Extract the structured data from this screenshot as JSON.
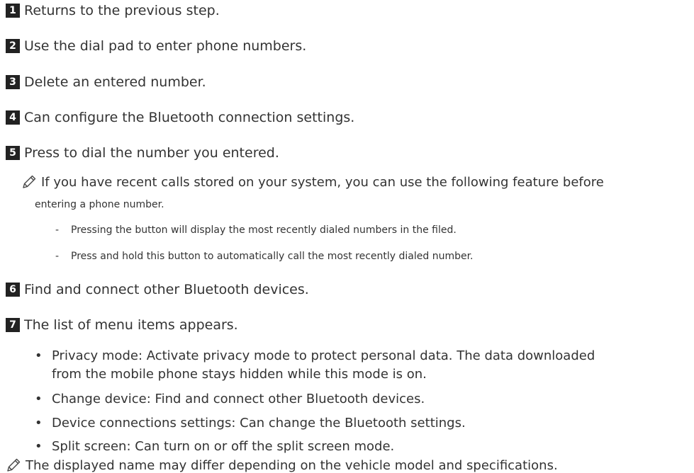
{
  "steps": [
    {
      "number": "1",
      "text": "Returns to the previous step."
    },
    {
      "number": "2",
      "text": "Use the dial pad to enter phone numbers."
    },
    {
      "number": "3",
      "text": "Delete an entered number."
    },
    {
      "number": "4",
      "text": "Can configure the Bluetooth connection settings."
    },
    {
      "number": "5",
      "text": "Press to dial the number you entered."
    },
    {
      "number": "6",
      "text": "Find and connect other Bluetooth devices."
    },
    {
      "number": "7",
      "text": "The list of menu items appears."
    }
  ],
  "step5_note": {
    "line1": "If you have recent calls stored on your system, you can use the following feature before",
    "line2": "entering a phone number.",
    "dash_items": [
      "Pressing the button will display the most recently dialed numbers in the filed.",
      "Press and hold this button to automatically call the most recently dialed number."
    ]
  },
  "step7_bullets": [
    {
      "line1": "Privacy mode: Activate privacy mode to protect personal data. The data downloaded",
      "line2": "from the mobile phone stays hidden while this mode is on."
    },
    {
      "line1": "Change device: Find and connect other Bluetooth devices."
    },
    {
      "line1": "Device connections settings: Can change the Bluetooth settings."
    },
    {
      "line1": "Split screen: Can turn on or off the split screen mode."
    }
  ],
  "footer_note": "The displayed name may differ depending on the vehicle model and specifications.",
  "icons": {
    "note": "pencil-icon"
  },
  "colors": {
    "badge_bg": "#222222",
    "text": "#333333"
  }
}
